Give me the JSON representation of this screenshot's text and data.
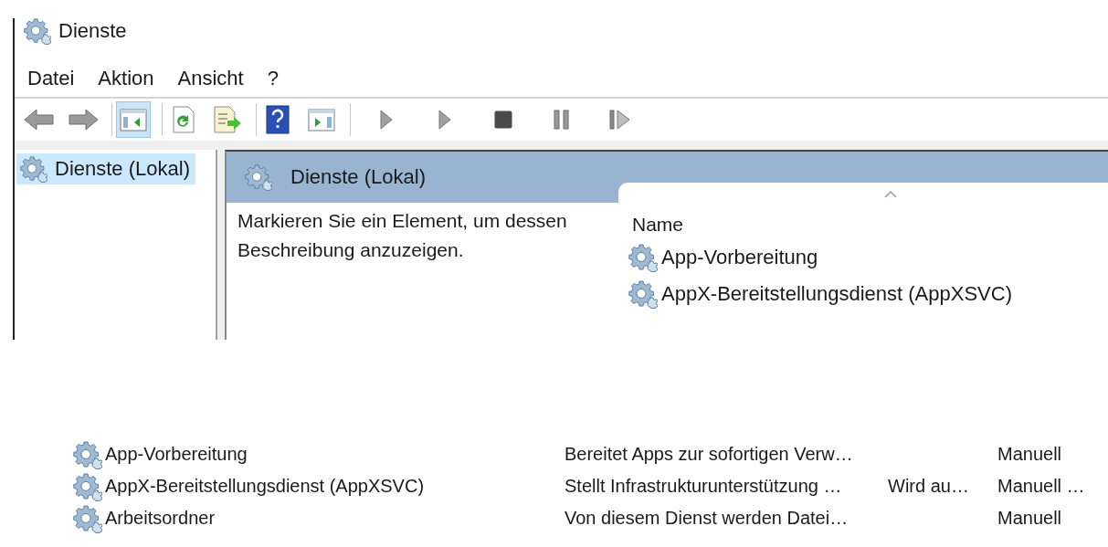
{
  "window": {
    "title": "Dienste"
  },
  "menu": [
    "Datei",
    "Aktion",
    "Ansicht",
    "?"
  ],
  "toolbar": [
    [
      {
        "kind": "back",
        "pressed": false
      },
      {
        "kind": "forward",
        "pressed": false
      }
    ],
    [
      {
        "kind": "console_tree",
        "pressed": true
      }
    ],
    [
      {
        "kind": "refresh",
        "pressed": false
      },
      {
        "kind": "export",
        "pressed": false
      }
    ],
    [
      {
        "kind": "help",
        "pressed": false
      },
      {
        "kind": "action_pane",
        "pressed": false
      }
    ],
    [
      {
        "kind": "start",
        "pressed": false
      },
      {
        "kind": "start",
        "pressed": false
      },
      {
        "kind": "stop",
        "pressed": false
      },
      {
        "kind": "pause",
        "pressed": false
      },
      {
        "kind": "resume",
        "pressed": false
      }
    ]
  ],
  "tree": [
    {
      "label": "Dienste (Lokal)",
      "selected": true
    }
  ],
  "pane": {
    "title": "Dienste (Lokal)",
    "description": "Markieren Sie ein Element, um dessen Beschreibung anzuzeigen.",
    "column": "Name",
    "rows": [
      "App-Vorbereitung",
      "AppX-Bereitstellungsdienst (AppXSVC)"
    ]
  },
  "table": {
    "rows": [
      {
        "name": "App-Vorbereitung",
        "column_2": "Bereitet Apps zur sofortigen Verw…",
        "column_4": "Manuell"
      },
      {
        "name": "AppX-Bereitstellungsdienst (AppXSVC)",
        "column_2": "Stellt Infrastrukturunterstützung …",
        "column_3": "Wird au…",
        "column_4": "Manuell …"
      },
      {
        "name": "Arbeitsordner",
        "column_2": "Von diesem Dienst werden Datei…",
        "column_4": "Manuell"
      }
    ]
  }
}
